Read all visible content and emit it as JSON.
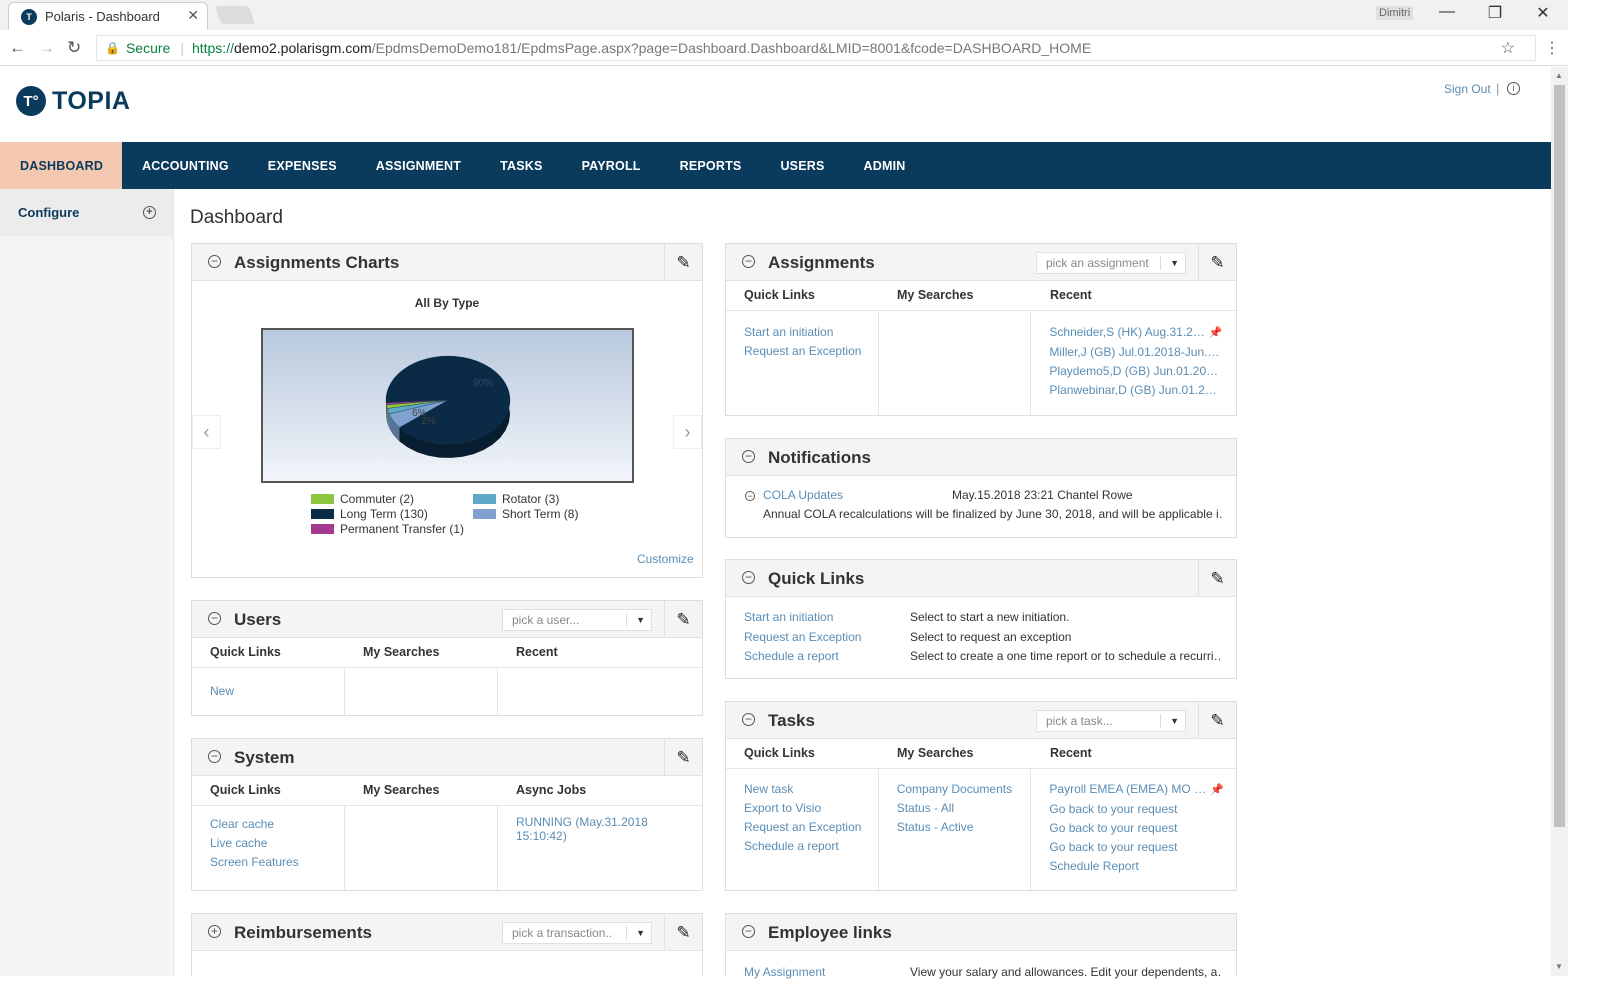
{
  "browser": {
    "tab_title": "Polaris - Dashboard",
    "favicon_text": "T",
    "user_badge": "Dimitri",
    "secure_label": "Secure",
    "url_scheme": "https://",
    "url_host": "demo2.polarisgm.com",
    "url_path": "/EpdmsDemoDemo181/EpdmsPage.aspx?page=Dashboard.Dashboard&LMID=8001&fcode=DASHBOARD_HOME"
  },
  "header": {
    "logo_mark": "T°",
    "logo_text": "TOPIA",
    "sign_out": "Sign Out",
    "separator": "|"
  },
  "nav": {
    "items": [
      "DASHBOARD",
      "ACCOUNTING",
      "EXPENSES",
      "ASSIGNMENT",
      "TASKS",
      "PAYROLL",
      "REPORTS",
      "USERS",
      "ADMIN"
    ],
    "active": "DASHBOARD"
  },
  "sidebar": {
    "configure": "Configure"
  },
  "page_title": "Dashboard",
  "assignments_charts": {
    "title": "Assignments Charts",
    "chart_heading": "All By Type",
    "customize": "Customize"
  },
  "chart_data": {
    "type": "pie",
    "title": "All By Type",
    "categories": [
      "Commuter",
      "Long Term",
      "Permanent Transfer",
      "Rotator",
      "Short Term"
    ],
    "values": [
      2,
      130,
      1,
      3,
      8
    ],
    "legend_labels": [
      "Commuter (2)",
      "Long Term (130)",
      "Permanent Transfer (1)",
      "Rotator (3)",
      "Short Term (8)"
    ],
    "colors": [
      "#8dc63f",
      "#0a2a45",
      "#a23b8f",
      "#5fa8c8",
      "#7fa2d0"
    ],
    "slice_labels": [
      "90%",
      "6%",
      "2%"
    ],
    "legend": "bottom"
  },
  "users_panel": {
    "title": "Users",
    "picker": "pick a user...",
    "columns": [
      "Quick Links",
      "My Searches",
      "Recent"
    ],
    "quick_links": [
      "New"
    ]
  },
  "system_panel": {
    "title": "System",
    "columns": [
      "Quick Links",
      "My Searches",
      "Async Jobs"
    ],
    "quick_links": [
      "Clear cache",
      "Live cache",
      "Screen Features"
    ],
    "async_jobs": [
      "RUNNING (May.31.2018",
      "15:10:42)"
    ]
  },
  "reimbursements_panel": {
    "title": "Reimbursements",
    "picker": "pick a transaction.."
  },
  "assignments_panel": {
    "title": "Assignments",
    "picker": "pick an assignment",
    "columns": [
      "Quick Links",
      "My Searches",
      "Recent"
    ],
    "quick_links": [
      "Start an initiation",
      "Request an Exception"
    ],
    "recent": [
      "Schneider,S (HK) Aug.31.2…",
      "Miller,J (GB) Jul.01.2018-Jun.…",
      "Playdemo5,D (GB) Jun.01.20…",
      "Planwebinar,D (GB) Jun.01.2…"
    ]
  },
  "notifications_panel": {
    "title": "Notifications",
    "item_title": "COLA Updates",
    "item_meta": "May.15.2018 23:21 Chantel Rowe",
    "item_body": "Annual COLA recalculations will be finalized by June 30, 2018, and will be applicable i…"
  },
  "quicklinks_panel": {
    "title": "Quick Links",
    "links": [
      {
        "label": "Start an initiation",
        "desc": "Select to start a new initiation."
      },
      {
        "label": "Request an Exception",
        "desc": "Select to request an exception"
      },
      {
        "label": "Schedule a report",
        "desc": "Select to create a one time report or to schedule a recurri…"
      }
    ]
  },
  "tasks_panel": {
    "title": "Tasks",
    "picker": "pick a task...",
    "columns": [
      "Quick Links",
      "My Searches",
      "Recent"
    ],
    "quick_links": [
      "New task",
      "Export to Visio",
      "Request an Exception",
      "Schedule a report"
    ],
    "my_searches": [
      "Company Documents",
      "Status - All",
      "Status - Active"
    ],
    "recent": [
      "Payroll EMEA (EMEA) MO …",
      "Go back to your request",
      "Go back to your request",
      "Go back to your request",
      "Schedule Report"
    ]
  },
  "employee_links_panel": {
    "title": "Employee links",
    "link": "My Assignment",
    "desc": "View your salary and allowances. Edit your dependents, a…"
  }
}
